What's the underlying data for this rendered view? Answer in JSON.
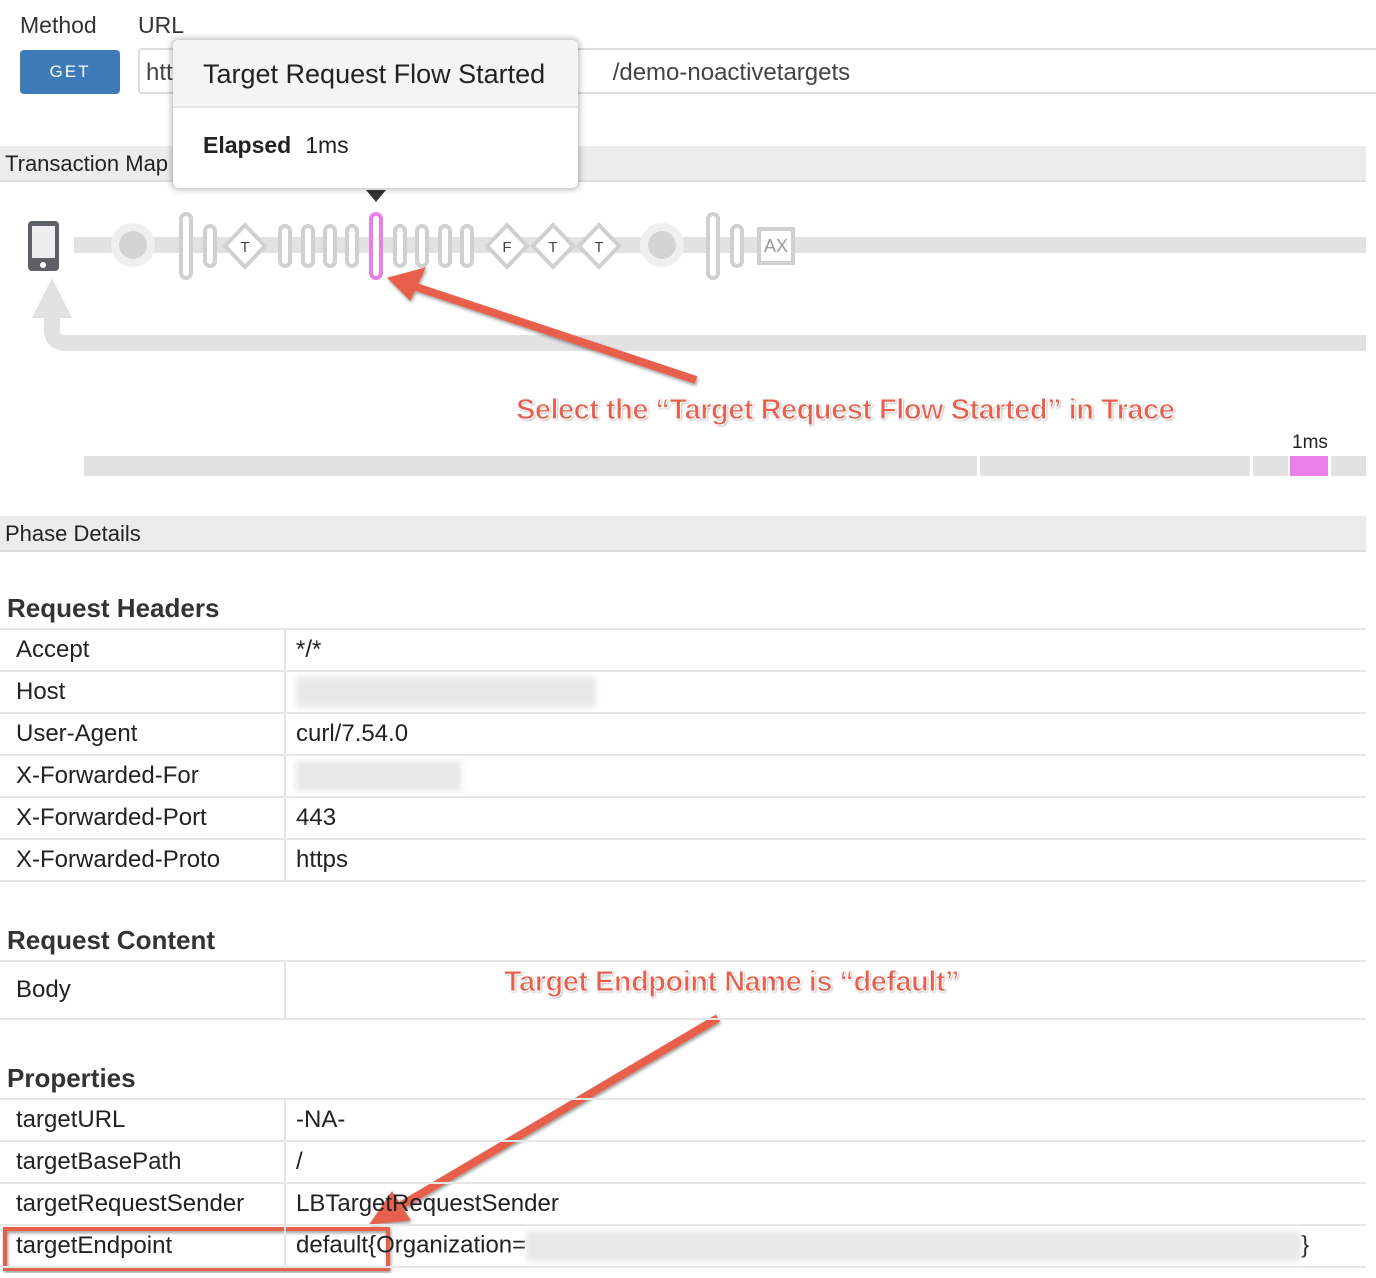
{
  "request": {
    "method_label": "Method",
    "url_label": "URL",
    "method": "GET",
    "url_start": "htt",
    "url_end": "/demo-noactivetargets"
  },
  "tooltip": {
    "title": "Target Request Flow Started",
    "elapsed_label": "Elapsed",
    "elapsed_value": "1ms"
  },
  "transaction_map": {
    "title": "Transaction Map",
    "nodes": [
      "T",
      "F",
      "T",
      "T",
      "AX"
    ],
    "selected": "Target Request Flow Started",
    "selected_color": "#e97fe9"
  },
  "timeline": {
    "label": "1ms",
    "highlight_color": "#e97fe9"
  },
  "annotations": {
    "trace": "Select the “Target Request Flow Started” in Trace",
    "endpoint": "Target Endpoint Name is “default”",
    "color": "#e8604c"
  },
  "phase_details": {
    "title": "Phase Details",
    "request_headers": {
      "title": "Request Headers",
      "rows": [
        [
          "Accept",
          "*/*"
        ],
        [
          "Host",
          ""
        ],
        [
          "User-Agent",
          "curl/7.54.0"
        ],
        [
          "X-Forwarded-For",
          ""
        ],
        [
          "X-Forwarded-Port",
          "443"
        ],
        [
          "X-Forwarded-Proto",
          "https"
        ]
      ]
    },
    "request_content": {
      "title": "Request Content",
      "rows": [
        [
          "Body",
          ""
        ]
      ]
    },
    "properties": {
      "title": "Properties",
      "rows": [
        [
          "targetURL",
          "-NA-"
        ],
        [
          "targetBasePath",
          "/"
        ],
        [
          "targetRequestSender",
          "LBTargetRequestSender"
        ],
        [
          "targetEndpoint",
          "default{Organization="
        ]
      ],
      "endpoint_suffix": "}"
    }
  }
}
